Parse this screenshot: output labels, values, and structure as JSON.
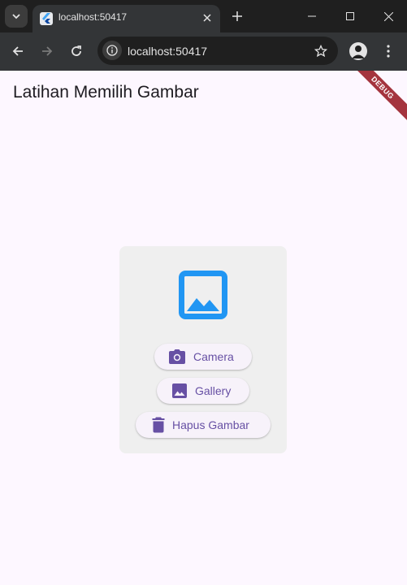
{
  "browser": {
    "tab_title": "localhost:50417",
    "url": "localhost:50417"
  },
  "app": {
    "title": "Latihan Memilih Gambar",
    "debug_banner": "DEBUG"
  },
  "card": {
    "icon": "image-icon",
    "buttons": {
      "camera": {
        "label": "Camera",
        "icon": "camera-icon"
      },
      "gallery": {
        "label": "Gallery",
        "icon": "image-icon"
      },
      "delete": {
        "label": "Hapus Gambar",
        "icon": "trash-icon"
      }
    }
  },
  "colors": {
    "accent": "#6750a4",
    "image_icon": "#2196f3",
    "debug": "#a4343e",
    "background": "#fdf7ff"
  }
}
